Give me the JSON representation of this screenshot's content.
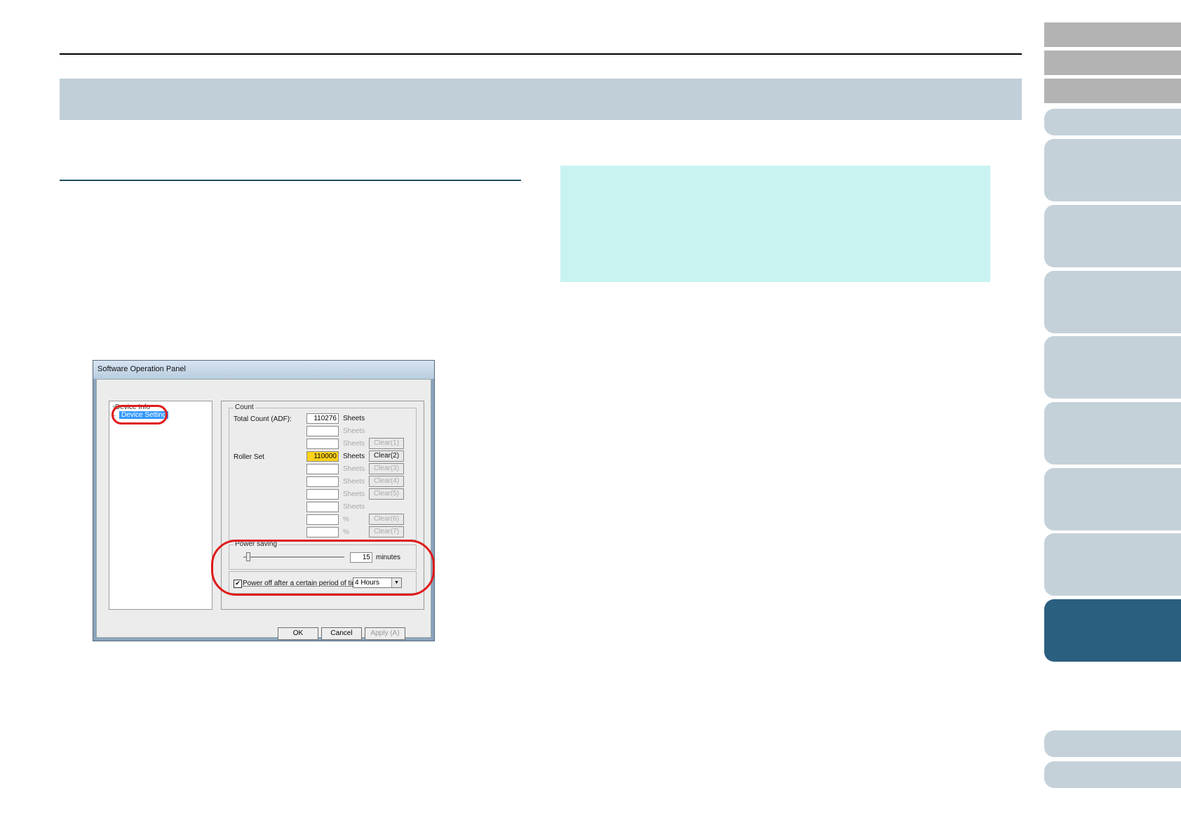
{
  "dialog": {
    "title": "Software Operation Panel",
    "tree": {
      "item1": "Device Info",
      "item2": "Device Setting"
    },
    "count_group": {
      "label": "Count",
      "total_count_label": "Total Count (ADF):",
      "total_count_value": "110276",
      "roller_set_label": "Roller Set",
      "roller_set_value": "110000",
      "sheets": "Sheets",
      "percent": "%",
      "clear_buttons": [
        "Clear(1)",
        "Clear(2)",
        "Clear(3)",
        "Clear(4)",
        "Clear(5)",
        "Clear(6)",
        "Clear(7)"
      ]
    },
    "power_group": {
      "label": "Power saving",
      "minutes_value": "15",
      "minutes_unit": "minutes",
      "power_off_label": "Power off after a certain period of time",
      "power_off_checked": true,
      "power_off_selected": "4 Hours"
    },
    "buttons": {
      "ok": "OK",
      "cancel": "Cancel",
      "apply": "Apply (A)"
    }
  },
  "colors": {
    "title_band": "#c0cfd8",
    "hint_box": "#c9f3f1",
    "active_tab": "#2a5f80",
    "highlight_ring": "#e01a1a"
  }
}
